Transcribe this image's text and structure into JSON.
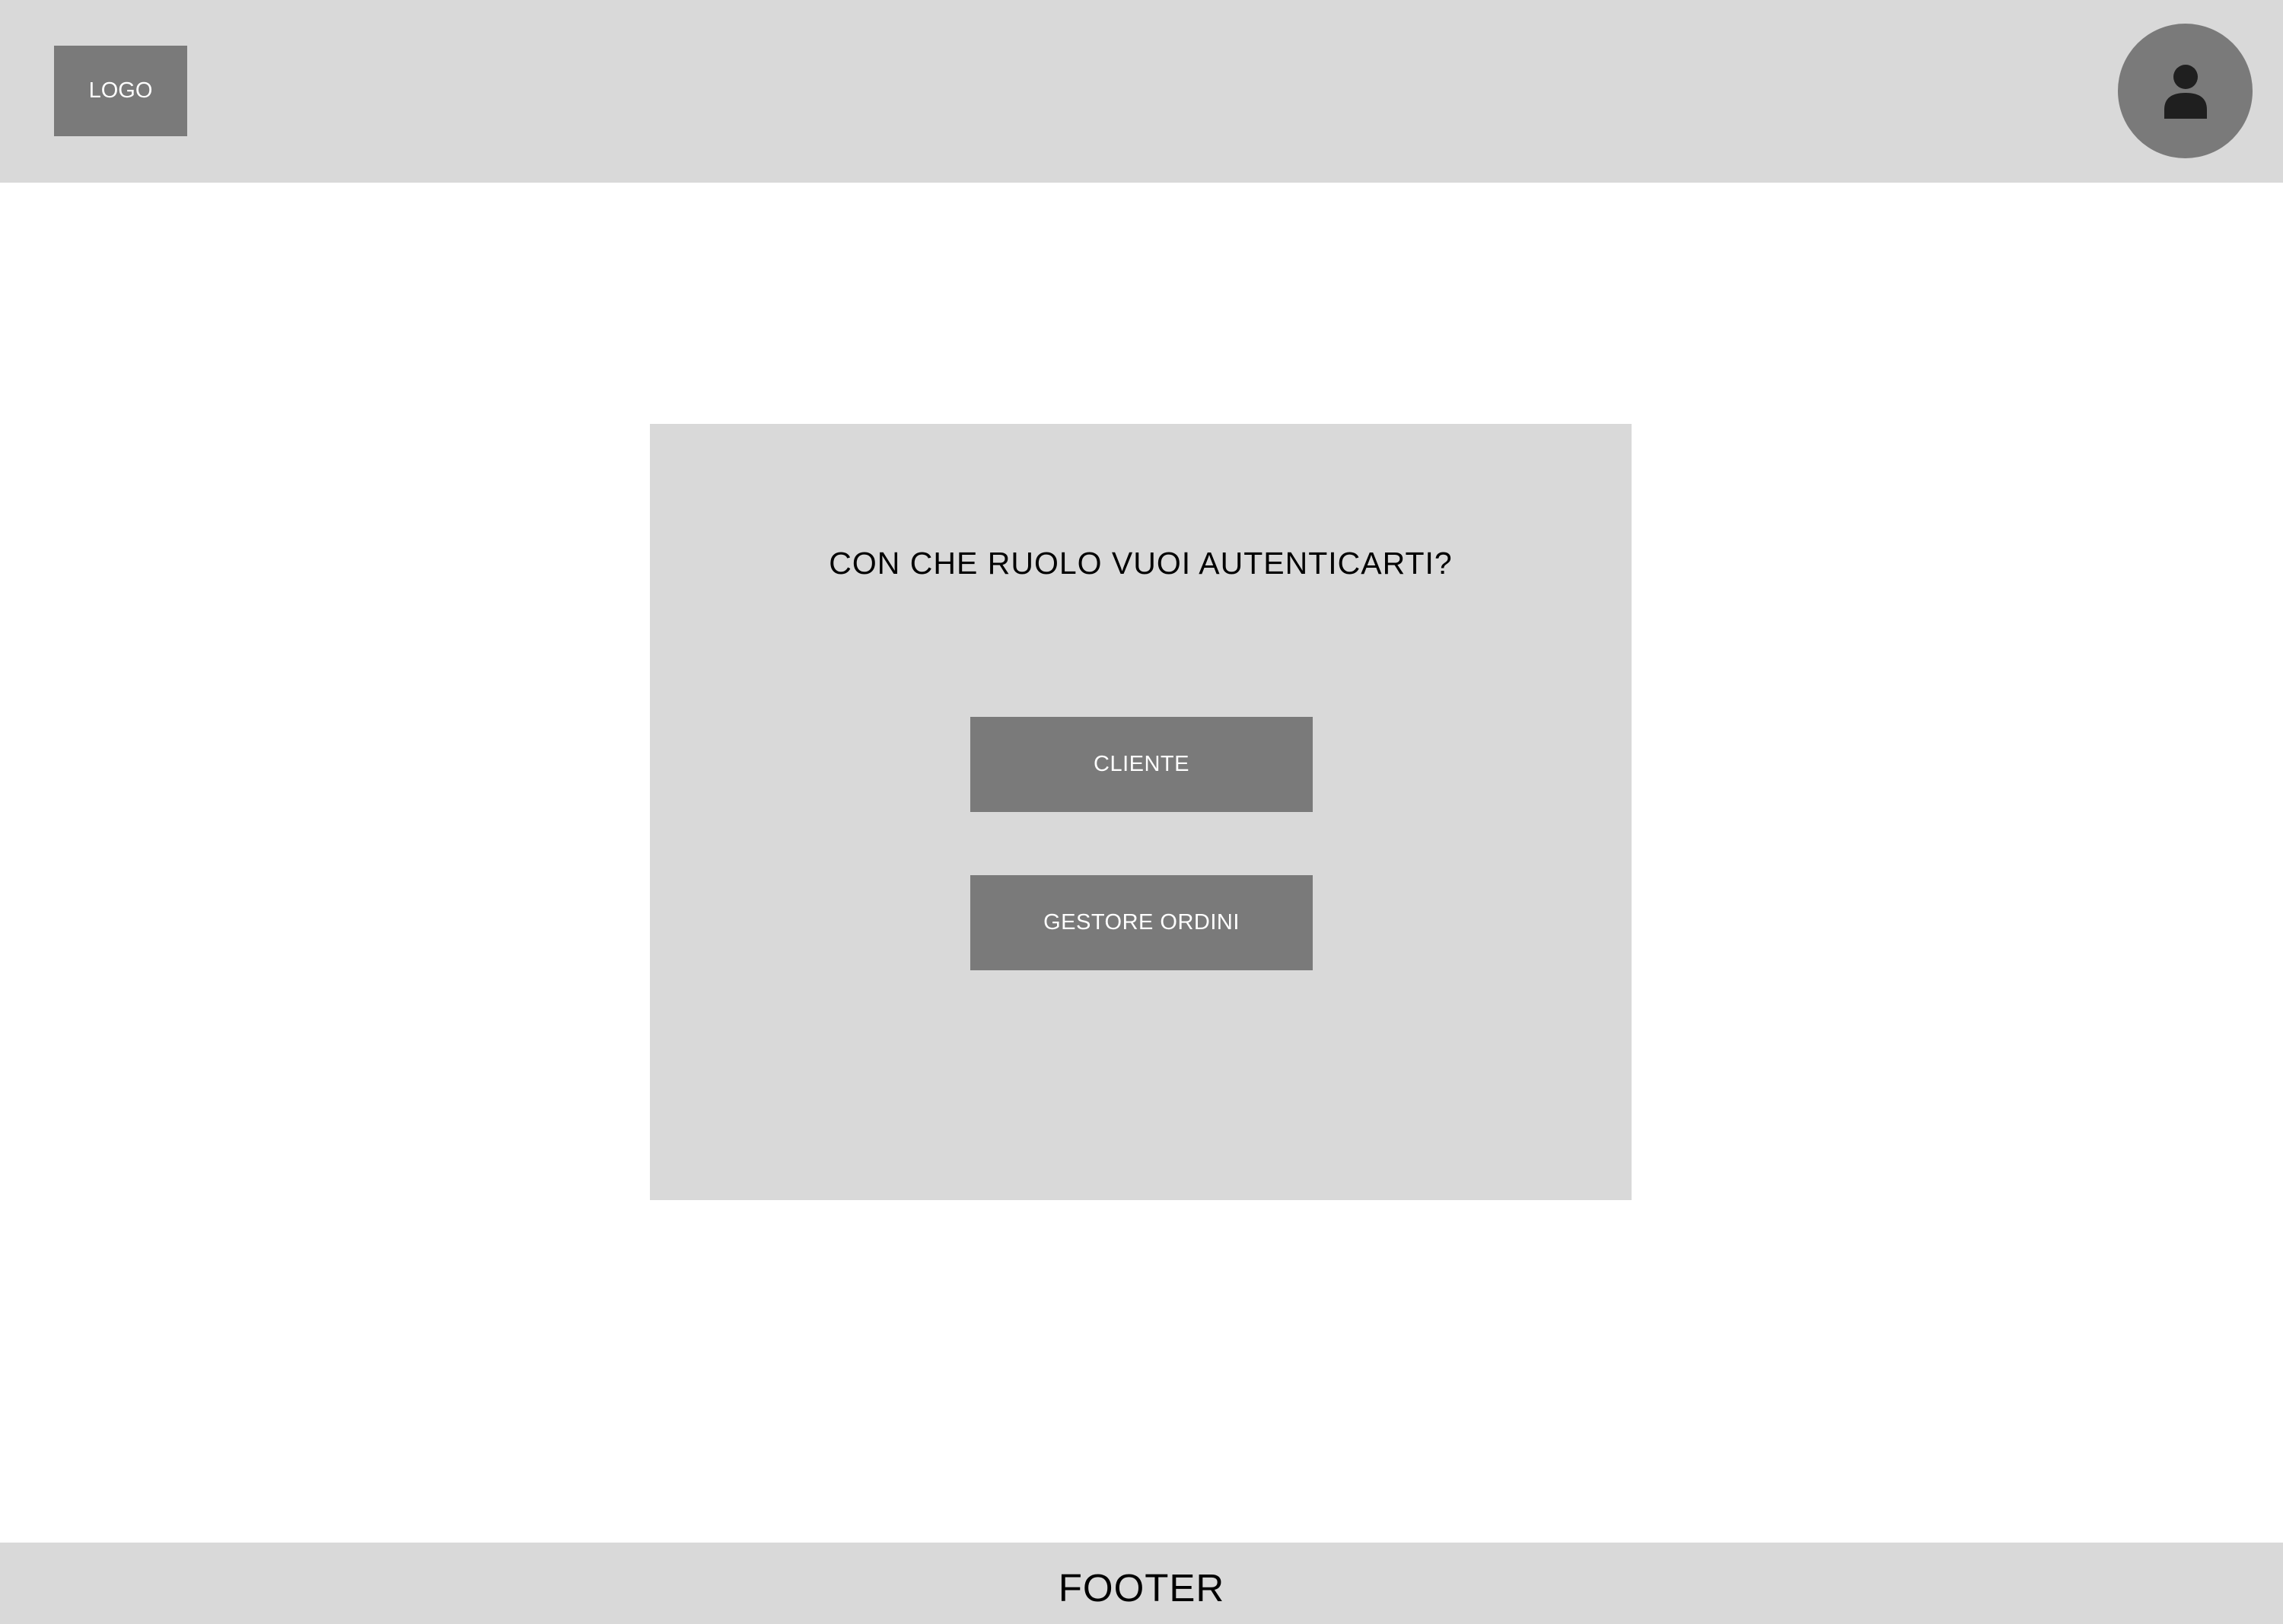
{
  "header": {
    "logo_label": "LOGO",
    "avatar_icon": "user-icon"
  },
  "card": {
    "title": "CON CHE RUOLO VUOI AUTENTICARTI?",
    "buttons": [
      {
        "label": "CLIENTE"
      },
      {
        "label": "GESTORE ORDINI"
      }
    ]
  },
  "footer": {
    "label": "FOOTER"
  },
  "colors": {
    "panel": "#d9d9d9",
    "control": "#7a7a7a",
    "background": "#ffffff",
    "icon": "#1f1f1f"
  }
}
